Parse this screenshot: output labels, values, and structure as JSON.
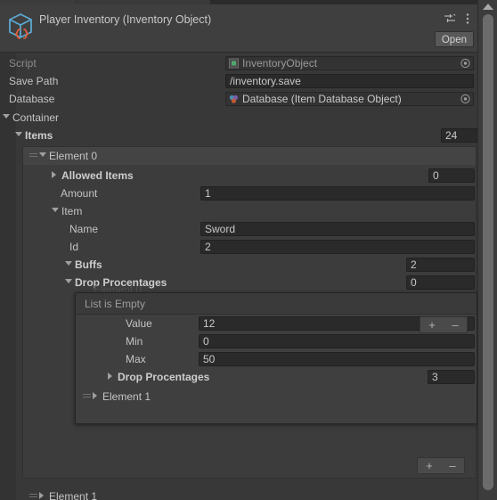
{
  "window": {
    "header_title": "Player Inventory (Inventory Object)",
    "open_label": "Open",
    "icon_name": "scriptable-object-icon",
    "preset_icon": "preset-settings-icon",
    "kebab_icon": "more-options-icon"
  },
  "properties": [
    {
      "label": "Script",
      "value": "InventoryObject",
      "kind": "object",
      "disabled": true
    },
    {
      "label": "Save Path",
      "value": "/inventory.save",
      "kind": "text",
      "disabled": false
    },
    {
      "label": "Database",
      "value": "Database (Item Database Object)",
      "kind": "object",
      "disabled": false
    }
  ],
  "container": {
    "label": "Container",
    "items": {
      "label": "Items",
      "count": "24",
      "element0": {
        "label": "Element 0",
        "allowed_items": {
          "label": "Allowed Items",
          "count": "0"
        },
        "amount": {
          "label": "Amount",
          "value": "1"
        },
        "item": {
          "label": "Item",
          "name": {
            "label": "Name",
            "value": "Sword"
          },
          "id": {
            "label": "Id",
            "value": "2"
          },
          "buffs": {
            "label": "Buffs",
            "count": "2"
          },
          "drop_procentages": {
            "label": "Drop Procentages",
            "count": "0"
          }
        }
      },
      "element1": {
        "label": "Element 1"
      }
    }
  },
  "overlay": {
    "empty_text": "List is Empty",
    "ghost_label": "Element 0",
    "fields": [
      {
        "label": "Value",
        "value": "12"
      },
      {
        "label": "Min",
        "value": "0"
      },
      {
        "label": "Max",
        "value": "50"
      }
    ],
    "nested_list": {
      "label": "Drop Procentages",
      "count": "3"
    },
    "element1": {
      "label": "Element 1"
    },
    "add_label": "+",
    "remove_label": "–"
  },
  "list_footer": {
    "add_label": "+",
    "remove_label": "–"
  },
  "bottom": {
    "element1": {
      "label": "Element 1"
    }
  },
  "colors": {
    "background": "#383838",
    "header": "#3f3f3f",
    "field": "#2a2a2a",
    "accent_icon": "#5ba8d0",
    "accent_brace": "#e0603a"
  }
}
